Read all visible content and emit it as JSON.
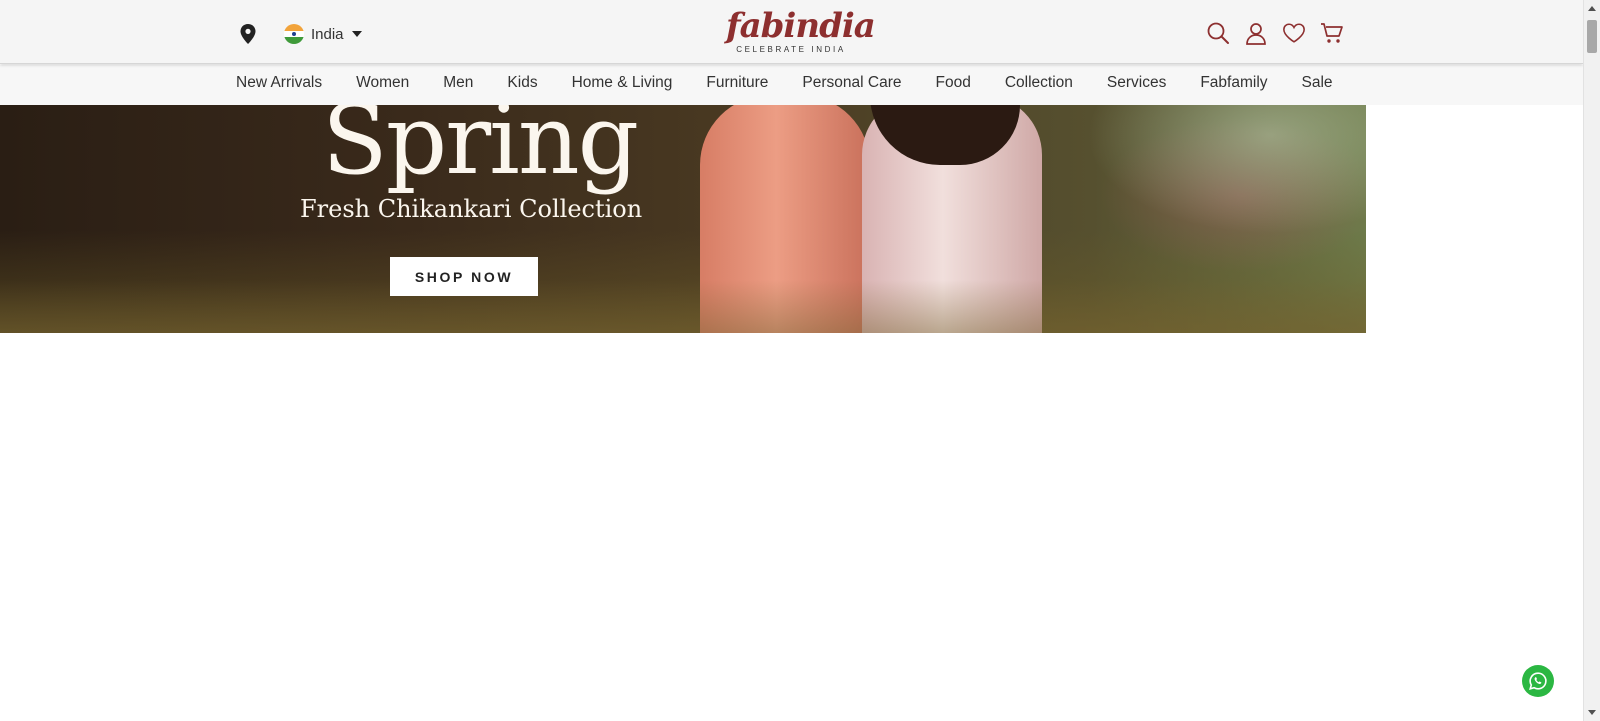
{
  "header": {
    "location_icon": "map-pin-icon",
    "country": {
      "name": "India",
      "flag": "india-flag-icon"
    },
    "logo": {
      "wordmark": "fabindia",
      "tagline": "CELEBRATE INDIA",
      "color": "#8d2f2f"
    },
    "icons": [
      "search-icon",
      "user-icon",
      "heart-icon",
      "cart-icon"
    ],
    "icon_color": "#8d2f2f"
  },
  "nav": {
    "items": [
      "New Arrivals",
      "Women",
      "Men",
      "Kids",
      "Home & Living",
      "Furniture",
      "Personal Care",
      "Food",
      "Collection",
      "Services",
      "Fabfamily",
      "Sale"
    ]
  },
  "hero": {
    "title": "Spring",
    "subtitle": "Fresh Chikankari Collection",
    "cta": "SHOP NOW"
  },
  "floating": {
    "whatsapp_icon": "whatsapp-icon",
    "color": "#2bb742"
  }
}
